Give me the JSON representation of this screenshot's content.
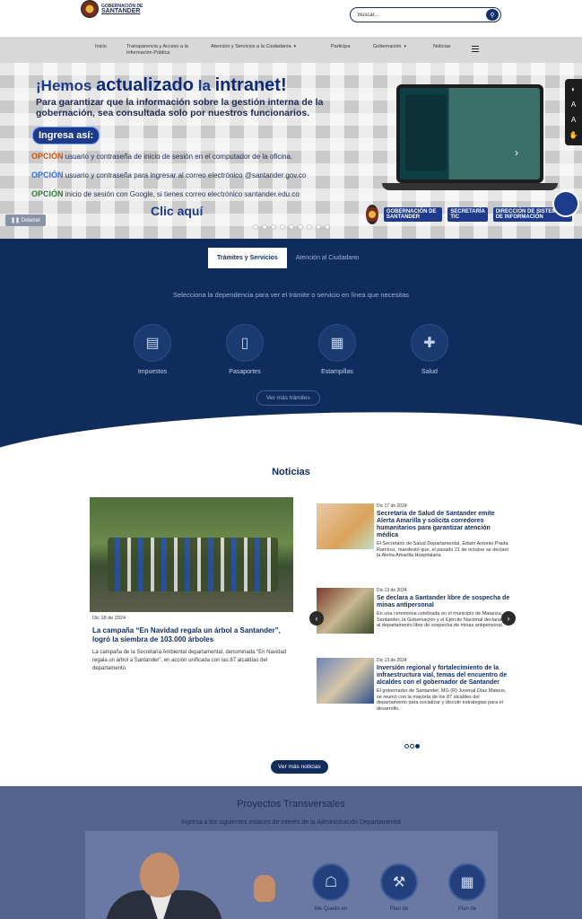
{
  "header": {
    "logo_line1": "GOBERNACIÓN DE",
    "logo_line2": "SANTANDER",
    "search_placeholder": "Buscar..."
  },
  "nav": {
    "items": [
      {
        "label": "Inicio"
      },
      {
        "label": "Transparencia y Acceso a la Información Pública"
      },
      {
        "label": "Atención y Servicios a la Ciudadanía",
        "caret": "▾"
      },
      {
        "label": "Participa"
      },
      {
        "label": "Gobernación",
        "caret": "▾"
      },
      {
        "label": "Noticias"
      }
    ]
  },
  "hero": {
    "h1_pre": "¡Hemos ",
    "h1_mid": "actualizado",
    "h1_la": " la ",
    "h1_end": "intranet!",
    "subtitle": "Para garantizar que la información sobre la gestión interna de la gobernación, sea consultada solo por nuestros funcionarios.",
    "pill": "Ingresa así:",
    "options": [
      {
        "tag": "OPCIÓN",
        "text": " usuario y contraseña de inicio de sesión en el computador de la oficina."
      },
      {
        "tag": "OPCIÓN",
        "text": " usuario y contraseña para ingresar al correo electrónico @santander.gov.co"
      },
      {
        "tag": "OPCIÓN",
        "text": " inicio de sesión con Google, si tienes correo electrónico santander.edu.co"
      }
    ],
    "cta": "Clic aquí",
    "footer_badge1": "GOBERNACIÓN DE SANTANDER",
    "footer_badge2": "SECRETARÍA TIC",
    "footer_badge3": "DIRECCIÓN DE SISTEMAS DE INFORMACIÓN",
    "pause_label": "Detener"
  },
  "tramites": {
    "tabs": [
      "Trámites y Servicios",
      "Atención al Ciudadano"
    ],
    "lead": "Selecciona la dependencia para ver el trámite o servicio en línea que necesitas",
    "categories": [
      {
        "label": "Impuestos",
        "icon": "tax-document-icon"
      },
      {
        "label": "Pasaportes",
        "icon": "passport-icon"
      },
      {
        "label": "Estampillas",
        "icon": "stamp-icon"
      },
      {
        "label": "Salud",
        "icon": "health-icon"
      }
    ],
    "more_button": "Ver más trámites"
  },
  "news": {
    "title": "Noticias",
    "featured": {
      "date": "Dic 18 de 2024",
      "headline": "La campaña “En Navidad regala un árbol a Santander”, logró la siembra de 103.000 árboles",
      "summary": "La campaña de la Secretaría Ambiental departamental, denominada “En Navidad regala un árbol a Santander”, en acción unificada con las 87 alcaldías del departamento"
    },
    "side": [
      {
        "date": "Dic 17 de 2024",
        "headline": "Secretaría de Salud de Santander emite Alerta Amarilla y solicita corredores humanitarios para garantizar atención médica",
        "summary": "El Secretario de Salud Departamental, Edwin Antonio Prada Ramírez, manifestó que, el pasado 21 de octubre se declaró la Alerta Amarilla Hospitalaria"
      },
      {
        "date": "Dic 13 de 2024",
        "headline": "Se declara a Santander libre de sospecha de minas antipersonal",
        "summary": "En una ceremonia celebrada en el municipio de Matanza, Santander, la Gobernación y el Ejército Nacional declararon al departamento libre de sospecha de minas antipersonal."
      },
      {
        "date": "Dic 13 de 2024",
        "headline": "Inversión regional y fortalecimiento de la infraestructura vial, temas del encuentro de alcaldes con el gobernador de Santander",
        "summary": "El gobernador de Santander, MG (R) Juvenal Díaz Mateus, se reunió con la mayoría de los 87 alcaldes del departamento para socializar y discutir estrategias para el desarrollo."
      }
    ],
    "prev_arrow": "‹",
    "next_arrow": "›",
    "more_button": "Ver más noticias"
  },
  "proyectos": {
    "title": "Proyectos Transversales",
    "lead": "Ingresa a los siguientes enlaces de interés de la Administración Departamental",
    "items": [
      {
        "label": "Me Quedo en",
        "icon": "hand-heart-icon"
      },
      {
        "label": "Plan de",
        "icon": "tools-icon"
      },
      {
        "label": "Plan de",
        "icon": "calendar-icon"
      }
    ]
  },
  "colors": {
    "navy": "#0f2c5c",
    "accent_blue": "#1e3a8a",
    "nav_gray": "#d8d8d8",
    "proyectos_bg": "#55648f"
  }
}
